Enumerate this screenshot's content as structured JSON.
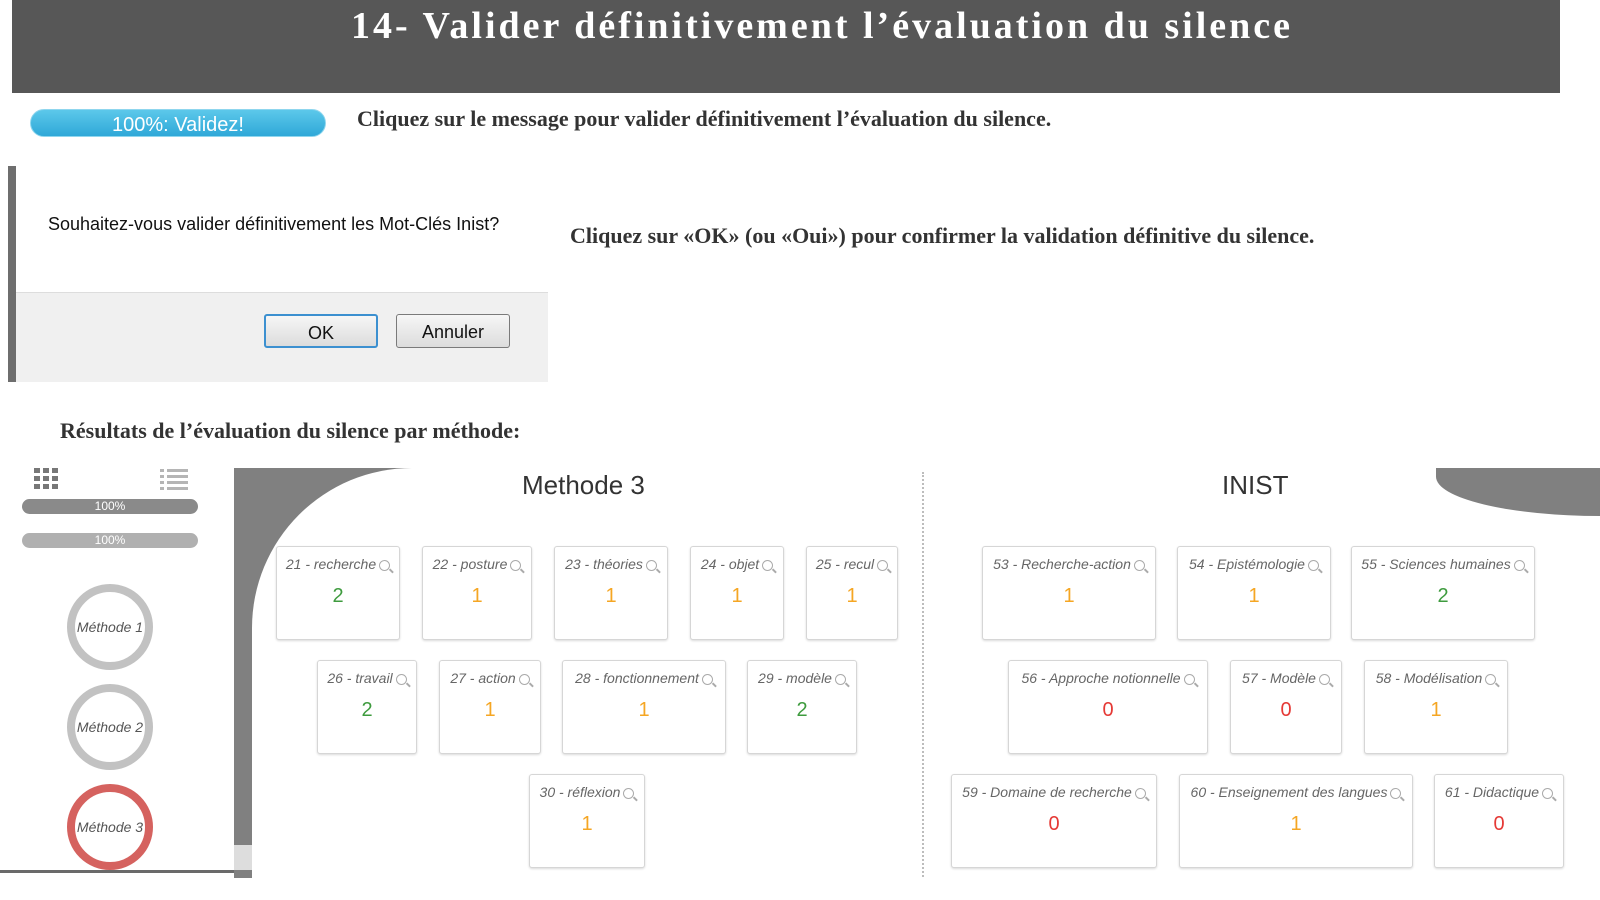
{
  "banner": {
    "title": "14- Valider définitivement l’évaluation du silence"
  },
  "validate_button": {
    "label": "100%: Validez!"
  },
  "instructions": {
    "step1": "Cliquez sur le message pour valider définitivement l’évaluation du silence.",
    "step2": "Cliquez sur «OK» (ou «Oui») pour confirmer la validation définitive du silence.",
    "results_heading": "Résultats de l’évaluation du silence par méthode:"
  },
  "dialog": {
    "message": "Souhaitez-vous valider définitivement les Mot-Clés Inist?",
    "ok_label": "OK",
    "cancel_label": "Annuler"
  },
  "sidebar": {
    "progress_bars": [
      {
        "label": "100%",
        "value": 100
      },
      {
        "label": "100%",
        "value": 100
      }
    ],
    "methods": [
      "Méthode 1",
      "Méthode 2",
      "Méthode 3"
    ],
    "active_method": "Méthode 3"
  },
  "columns": {
    "left_title": "Methode 3",
    "right_title": "INIST"
  },
  "keywords_methode3": [
    {
      "label": "21 - recherche",
      "count": "2",
      "color": "#3e9b3e"
    },
    {
      "label": "22 - posture",
      "count": "1",
      "color": "#f5a623"
    },
    {
      "label": "23 - théories",
      "count": "1",
      "color": "#f5a623"
    },
    {
      "label": "24 - objet",
      "count": "1",
      "color": "#f5a623"
    },
    {
      "label": "25 - recul",
      "count": "1",
      "color": "#f5a623"
    },
    {
      "label": "26 - travail",
      "count": "2",
      "color": "#3e9b3e"
    },
    {
      "label": "27 - action",
      "count": "1",
      "color": "#f5a623"
    },
    {
      "label": "28 - fonctionnement",
      "count": "1",
      "color": "#f5a623"
    },
    {
      "label": "29 - modèle",
      "count": "2",
      "color": "#3e9b3e"
    },
    {
      "label": "30 - réflexion",
      "count": "1",
      "color": "#f5a623"
    }
  ],
  "keywords_inist": [
    {
      "label": "53 - Recherche-action",
      "count": "1",
      "color": "#f5a623"
    },
    {
      "label": "54 - Epistémologie",
      "count": "1",
      "color": "#f5a623"
    },
    {
      "label": "55 - Sciences humaines",
      "count": "2",
      "color": "#3e9b3e"
    },
    {
      "label": "56 - Approche notionnelle",
      "count": "0",
      "color": "#e53935"
    },
    {
      "label": "57 - Modèle",
      "count": "0",
      "color": "#e53935"
    },
    {
      "label": "58 - Modélisation",
      "count": "1",
      "color": "#f5a623"
    },
    {
      "label": "59 - Domaine de recherche",
      "count": "0",
      "color": "#e53935"
    },
    {
      "label": "60 - Enseignement des langues",
      "count": "1",
      "color": "#f5a623"
    },
    {
      "label": "61 - Didactique",
      "count": "0",
      "color": "#e53935"
    }
  ],
  "icons": [
    "grid-view-icon",
    "list-view-icon",
    "search-icon"
  ]
}
